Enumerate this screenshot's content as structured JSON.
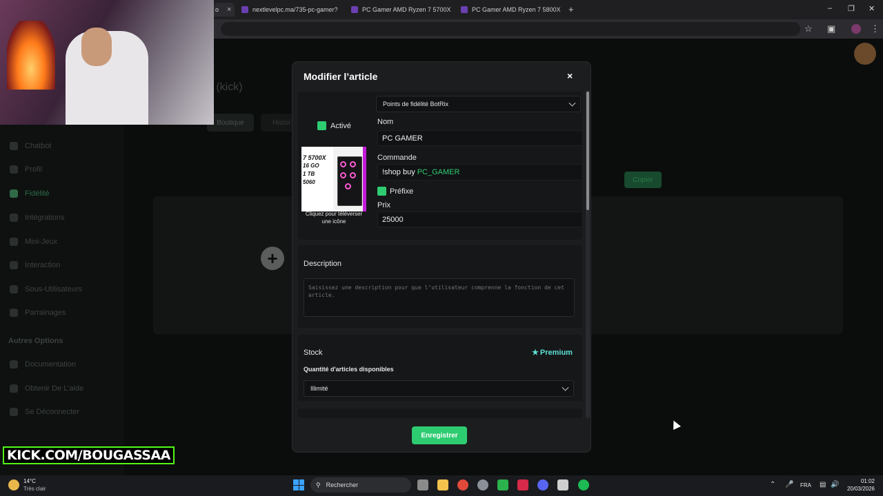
{
  "browser": {
    "tabs": [
      {
        "label": "o",
        "active": true
      },
      {
        "label": "nextlevelpc.ma/735-pc-gamer?"
      },
      {
        "label": "PC Gamer AMD Ryzen 7 5700X"
      },
      {
        "label": "PC Gamer AMD Ryzen 7 5800X"
      }
    ],
    "new_tab": "+",
    "close_glyph": "×"
  },
  "background": {
    "page_title": "é (kick)",
    "tabs": [
      "Boutique",
      "Histor"
    ],
    "copy_button": "Copier",
    "sidebar": {
      "items": [
        {
          "label": "Chatbot"
        },
        {
          "label": "Profil"
        },
        {
          "label": "Fidélité",
          "active": true
        },
        {
          "label": "Intégrations"
        },
        {
          "label": "Mini-Jeux"
        },
        {
          "label": "Interaction"
        },
        {
          "label": "Sous-Utilisateurs"
        },
        {
          "label": "Parrainages"
        }
      ],
      "section_title": "Autres Options",
      "other_items": [
        {
          "label": "Documentation"
        },
        {
          "label": "Obtenir De L'aide"
        },
        {
          "label": "Se Déconnecter"
        }
      ]
    }
  },
  "overlay": {
    "kick_banner": "KICK.COM/BOUGASSAA"
  },
  "modal": {
    "title": "Modifier l’article",
    "close": "×",
    "currency_select": "Points de fidélité BotRix",
    "active_label": "Activé",
    "icon_caption": "Cliquez pour téléverser une icône",
    "icon_image_text": [
      "7 5700X",
      "16 GO",
      "1 TB",
      "5060"
    ],
    "name_label": "Nom",
    "name_value": "PC GAMER",
    "command_label": "Commande",
    "command_prefix": "!shop buy",
    "command_arg": "PC_GAMER",
    "prefix_label": "Préfixe",
    "price_label": "Prix",
    "price_value": "25000",
    "description_label": "Description",
    "description_placeholder": "Saisissez une description pour que l’utilisateur comprenne la fonction de cet article.",
    "stock_label": "Stock",
    "premium_label": "Premium",
    "quantity_label": "Quantité d'articles disponibles",
    "stock_select": "Illimité",
    "save_button": "Enregistrer"
  },
  "taskbar": {
    "weather_temp": "14°C",
    "weather_desc": "Très clair",
    "search_placeholder": "Rechercher",
    "language": "FRA",
    "time": "01:02",
    "date": "20/03/2026"
  },
  "colors": {
    "accent": "#2ecc71",
    "premium": "#5de0d2",
    "modal_bg": "#1c1d1f"
  }
}
